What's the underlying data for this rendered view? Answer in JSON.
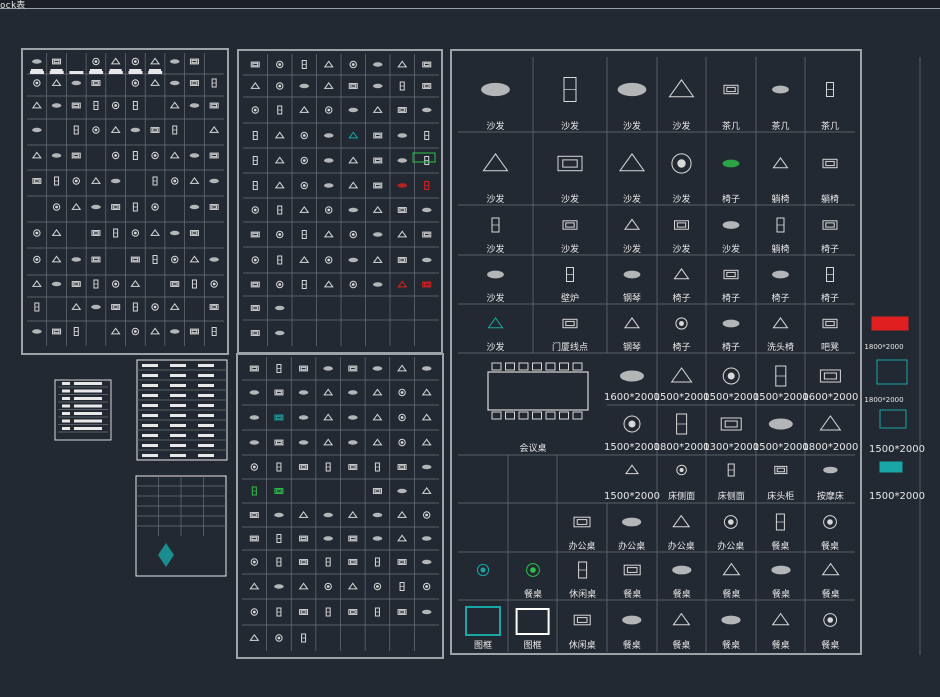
{
  "window": {
    "tab_label": "ock表"
  },
  "colors": {
    "background": "#232932",
    "frame": "#9ea3a8",
    "grid": "#6a717a",
    "symbol": "#d8d8d8",
    "accent_red": "#e02020",
    "accent_cyan": "#19a6a6",
    "accent_green": "#2ec24a"
  },
  "right_table": {
    "rows": [
      [
        "沙发",
        "沙发",
        "沙发",
        "沙发",
        "茶几",
        "茶几",
        "茶几"
      ],
      [
        "沙发",
        "沙发",
        "沙发",
        "沙发",
        "椅子",
        "躺椅",
        "躺椅"
      ],
      [
        "沙发",
        "沙发",
        "沙发",
        "沙发",
        "沙发",
        "躺椅",
        "椅子"
      ],
      [
        "沙发",
        "壁炉",
        "钢琴",
        "椅子",
        "椅子",
        "椅子",
        "椅子"
      ],
      [
        "沙发",
        "门厦线点",
        "钢琴",
        "椅子",
        "椅子",
        "洗头椅",
        "吧凳"
      ]
    ],
    "bed_row1": [
      "1600*2000",
      "1500*2000",
      "1500*2000",
      "1500*2000",
      "1600*2000"
    ],
    "bed_row2": [
      "1500*2000",
      "1800*2000",
      "1300*2000",
      "1500*2000",
      "1800*2000"
    ],
    "bed_row3": [
      "1500*2000",
      "床侧面",
      "床侧面",
      "床头柜",
      "按摩床"
    ],
    "meeting_label": "会议桌",
    "table_row1": [
      "办公桌",
      "办公桌",
      "办公桌",
      "办公桌",
      "餐桌",
      "餐桌"
    ],
    "table_row2": [
      "餐桌",
      "休闲桌",
      "餐桌",
      "餐桌",
      "餐桌",
      "餐桌",
      "餐桌"
    ],
    "table_row3": [
      "图框",
      "图框",
      "休闲桌",
      "餐桌",
      "餐桌",
      "餐桌",
      "餐桌",
      "餐桌"
    ],
    "outside": [
      "1800*2000",
      "1800*2000",
      "1500*2000",
      "1500*2000"
    ]
  }
}
